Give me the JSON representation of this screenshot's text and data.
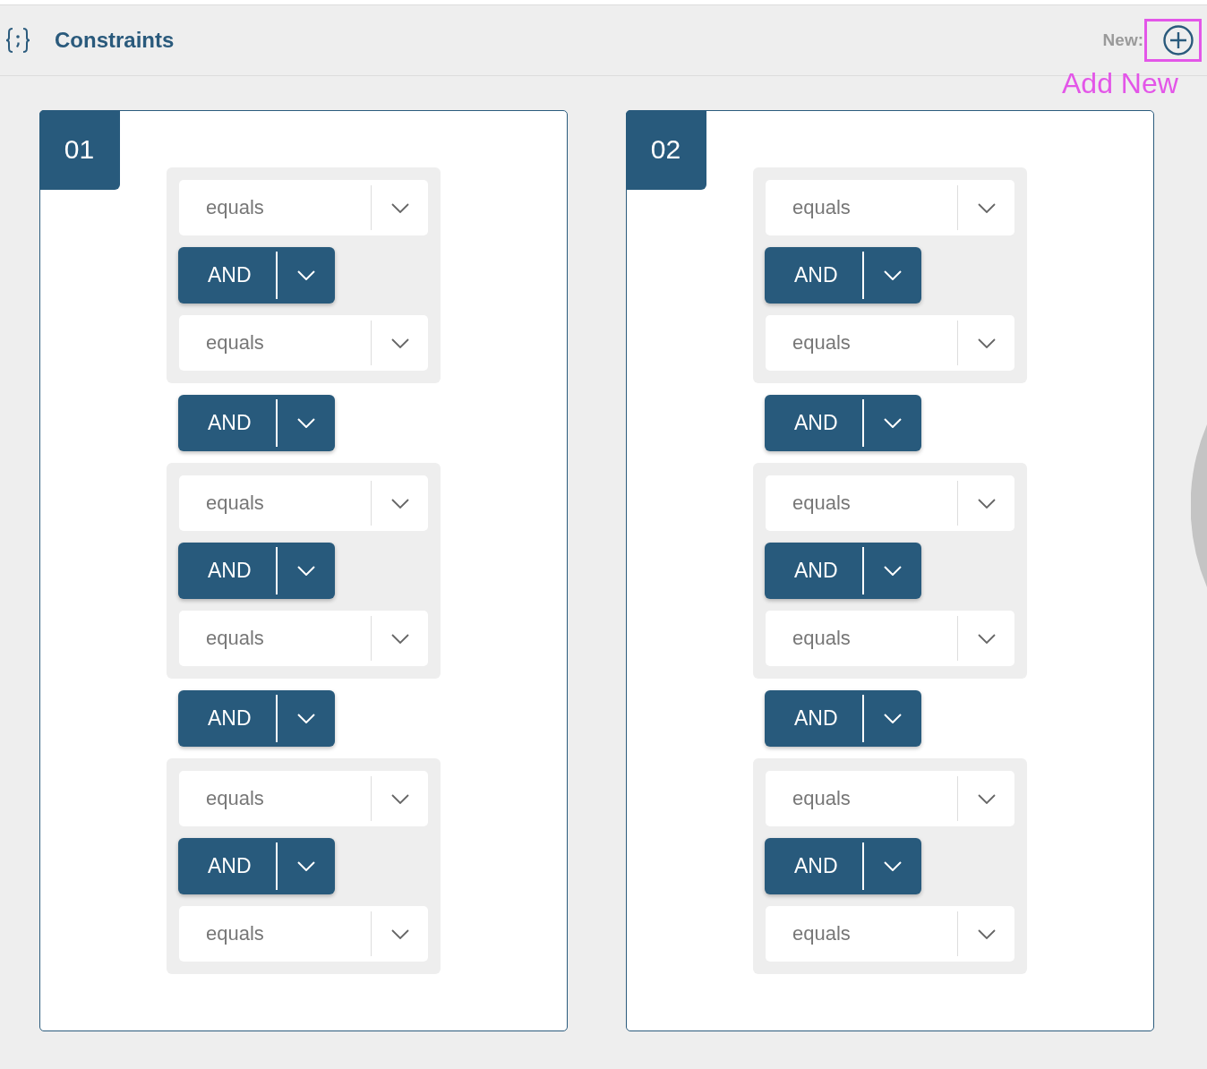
{
  "header": {
    "title": "Constraints",
    "new_label": "New:",
    "add_button": {
      "highlighted": true
    }
  },
  "annotation": {
    "text": "Add New"
  },
  "cards": [
    {
      "number": "01",
      "items": [
        {
          "kind": "group",
          "rows": [
            {
              "kind": "select",
              "value": "equals"
            },
            {
              "kind": "operator",
              "value": "AND"
            },
            {
              "kind": "select",
              "value": "equals"
            }
          ]
        },
        {
          "kind": "operator",
          "value": "AND"
        },
        {
          "kind": "group",
          "rows": [
            {
              "kind": "select",
              "value": "equals"
            },
            {
              "kind": "operator",
              "value": "AND"
            },
            {
              "kind": "select",
              "value": "equals"
            }
          ]
        },
        {
          "kind": "operator",
          "value": "AND"
        },
        {
          "kind": "group",
          "rows": [
            {
              "kind": "select",
              "value": "equals"
            },
            {
              "kind": "operator",
              "value": "AND"
            },
            {
              "kind": "select",
              "value": "equals"
            }
          ]
        }
      ]
    },
    {
      "number": "02",
      "items": [
        {
          "kind": "group",
          "rows": [
            {
              "kind": "select",
              "value": "equals"
            },
            {
              "kind": "operator",
              "value": "AND"
            },
            {
              "kind": "select",
              "value": "equals"
            }
          ]
        },
        {
          "kind": "operator",
          "value": "AND"
        },
        {
          "kind": "group",
          "rows": [
            {
              "kind": "select",
              "value": "equals"
            },
            {
              "kind": "operator",
              "value": "AND"
            },
            {
              "kind": "select",
              "value": "equals"
            }
          ]
        },
        {
          "kind": "operator",
          "value": "AND"
        },
        {
          "kind": "group",
          "rows": [
            {
              "kind": "select",
              "value": "equals"
            },
            {
              "kind": "operator",
              "value": "AND"
            },
            {
              "kind": "select",
              "value": "equals"
            }
          ]
        }
      ]
    }
  ]
}
